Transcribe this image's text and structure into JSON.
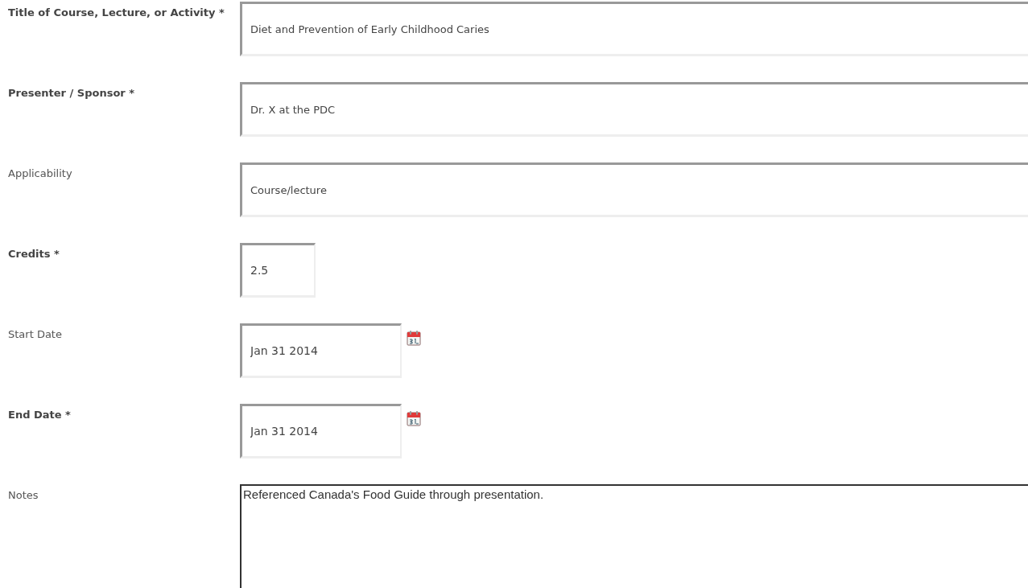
{
  "fields": [
    {
      "label": "Title of Course, Lecture, or Activity *",
      "required": true,
      "kind": "text",
      "value": "Diet and Prevention of Early Childhood Caries"
    },
    {
      "label": "Presenter / Sponsor *",
      "required": true,
      "kind": "text",
      "value": "Dr. X at the PDC"
    },
    {
      "label": "Applicability",
      "required": false,
      "kind": "text",
      "value": "Course/lecture"
    },
    {
      "label": "Credits *",
      "required": true,
      "kind": "short",
      "value": "2.5"
    },
    {
      "label": "Start Date",
      "required": false,
      "kind": "date",
      "value": "Jan 31 2014"
    },
    {
      "label": "End Date *",
      "required": true,
      "kind": "date",
      "value": "Jan 31 2014"
    },
    {
      "label": "Notes",
      "required": false,
      "kind": "textarea",
      "value": "Referenced Canada's Food Guide through presentation."
    }
  ]
}
